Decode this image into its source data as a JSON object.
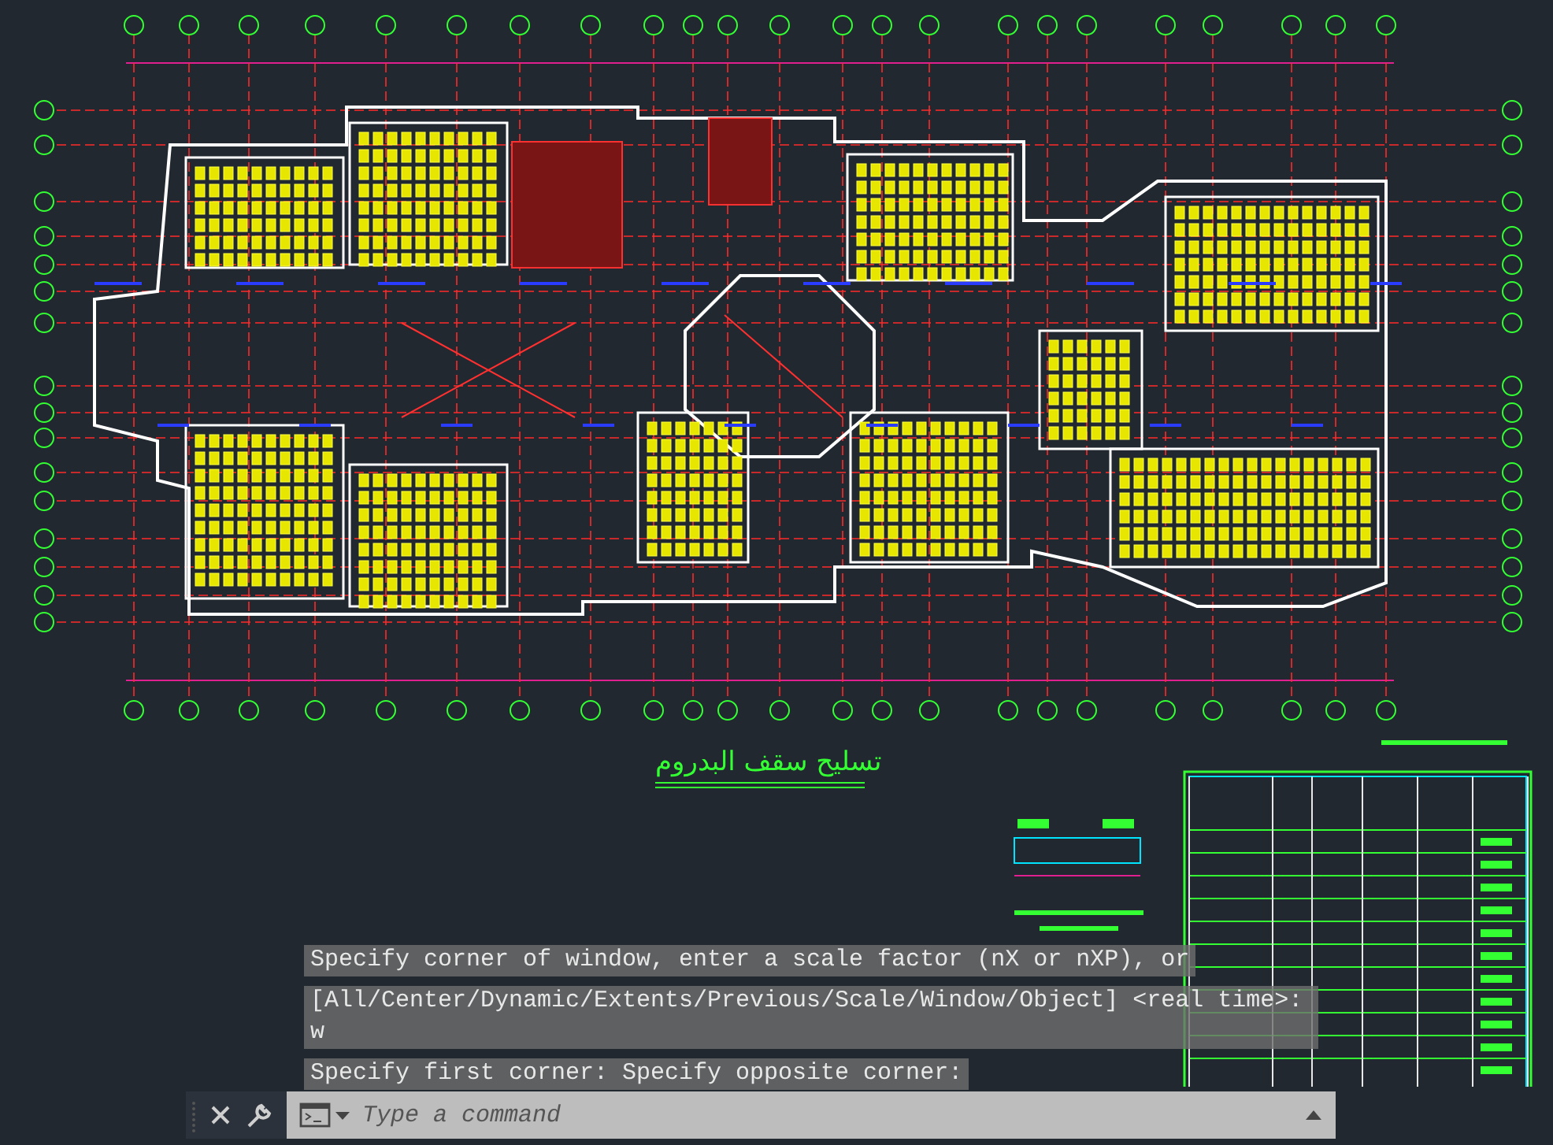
{
  "drawing": {
    "title": "تسليح سقف البدروم"
  },
  "command_history": [
    {
      "text": "Specify corner of window, enter a scale factor (nX or nXP), or"
    },
    {
      "text": "[All/Center/Dynamic/Extents/Previous/Scale/Window/Object] <real time>: w"
    },
    {
      "text": "Specify first corner: Specify opposite corner:"
    }
  ],
  "command_line": {
    "placeholder": "Type a command"
  }
}
